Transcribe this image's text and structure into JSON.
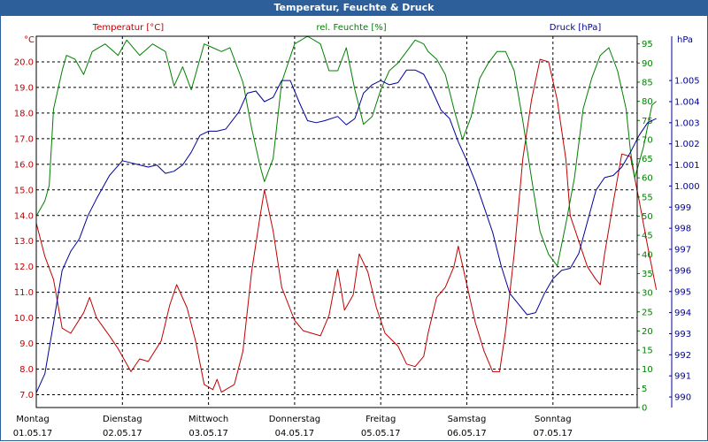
{
  "window": {
    "title": "Temperatur, Feuchte & Druck"
  },
  "chart_data": {
    "type": "line",
    "title": "Temperatur, Feuchte & Druck",
    "grid": true,
    "x_range_days": [
      0,
      7
    ],
    "x_ticks": [
      {
        "day": "Montag",
        "date": "01.05.17"
      },
      {
        "day": "Dienstag",
        "date": "02.05.17"
      },
      {
        "day": "Mittwoch",
        "date": "03.05.17"
      },
      {
        "day": "Donnerstag",
        "date": "04.05.17"
      },
      {
        "day": "Freitag",
        "date": "05.05.17"
      },
      {
        "day": "Samstag",
        "date": "06.05.17"
      },
      {
        "day": "Sonntag",
        "date": "07.05.17"
      }
    ],
    "axes": {
      "temperature": {
        "label": "Temperatur [°C]",
        "unit": "°C",
        "color": "#c00000",
        "range": [
          6.5,
          21.0
        ],
        "ticks": [
          "7.0",
          "8.0",
          "9.0",
          "10.0",
          "11.0",
          "12.0",
          "13.0",
          "14.0",
          "15.0",
          "16.0",
          "17.0",
          "18.0",
          "19.0",
          "20.0"
        ]
      },
      "humidity": {
        "label": "rel. Feuchte [%]",
        "unit": "%",
        "color": "#008000",
        "range": [
          0,
          97
        ],
        "ticks": [
          "0",
          "5",
          "10",
          "15",
          "20",
          "25",
          "30",
          "35",
          "40",
          "45",
          "50",
          "55",
          "60",
          "65",
          "70",
          "75",
          "80",
          "85",
          "90",
          "95"
        ]
      },
      "pressure": {
        "label": "Druck [hPa]",
        "unit": "hPa",
        "color": "#000099",
        "range": [
          989.5,
          1007.1
        ],
        "ticks": [
          "990",
          "991",
          "992",
          "993",
          "994",
          "995",
          "996",
          "997",
          "998",
          "999",
          "1.000",
          "1.001",
          "1.002",
          "1.003",
          "1.004",
          "1.005"
        ]
      }
    },
    "series": [
      {
        "name": "Temperatur [°C]",
        "axis": "temperature",
        "color": "#c00000",
        "points": [
          [
            0,
            13.7
          ],
          [
            0.1,
            12.4
          ],
          [
            0.2,
            11.5
          ],
          [
            0.3,
            9.6
          ],
          [
            0.4,
            9.4
          ],
          [
            0.55,
            10.2
          ],
          [
            0.62,
            10.8
          ],
          [
            0.7,
            10.0
          ],
          [
            0.85,
            9.3
          ],
          [
            0.95,
            8.8
          ],
          [
            1.1,
            7.9
          ],
          [
            1.2,
            8.4
          ],
          [
            1.3,
            8.3
          ],
          [
            1.45,
            9.1
          ],
          [
            1.55,
            10.5
          ],
          [
            1.63,
            11.3
          ],
          [
            1.75,
            10.4
          ],
          [
            1.85,
            9.1
          ],
          [
            1.95,
            7.4
          ],
          [
            2.05,
            7.2
          ],
          [
            2.1,
            7.6
          ],
          [
            2.15,
            7.1
          ],
          [
            2.3,
            7.4
          ],
          [
            2.4,
            8.7
          ],
          [
            2.5,
            11.8
          ],
          [
            2.6,
            14.0
          ],
          [
            2.65,
            15.0
          ],
          [
            2.75,
            13.4
          ],
          [
            2.85,
            11.2
          ],
          [
            3.0,
            9.9
          ],
          [
            3.1,
            9.5
          ],
          [
            3.2,
            9.4
          ],
          [
            3.3,
            9.3
          ],
          [
            3.4,
            10.1
          ],
          [
            3.5,
            11.9
          ],
          [
            3.58,
            10.3
          ],
          [
            3.68,
            10.9
          ],
          [
            3.75,
            12.5
          ],
          [
            3.85,
            11.8
          ],
          [
            3.95,
            10.4
          ],
          [
            4.05,
            9.4
          ],
          [
            4.2,
            8.9
          ],
          [
            4.3,
            8.2
          ],
          [
            4.4,
            8.1
          ],
          [
            4.5,
            8.5
          ],
          [
            4.55,
            9.4
          ],
          [
            4.65,
            10.8
          ],
          [
            4.75,
            11.2
          ],
          [
            4.85,
            12.0
          ],
          [
            4.9,
            12.8
          ],
          [
            5.0,
            11.3
          ],
          [
            5.1,
            9.8
          ],
          [
            5.2,
            8.7
          ],
          [
            5.3,
            7.9
          ],
          [
            5.38,
            7.9
          ],
          [
            5.45,
            9.5
          ],
          [
            5.55,
            12.5
          ],
          [
            5.65,
            16.2
          ],
          [
            5.75,
            18.5
          ],
          [
            5.85,
            20.1
          ],
          [
            5.95,
            20.0
          ],
          [
            6.05,
            18.5
          ],
          [
            6.15,
            16.2
          ],
          [
            6.2,
            14.0
          ],
          [
            6.3,
            13.0
          ],
          [
            6.4,
            12.0
          ],
          [
            6.5,
            11.5
          ],
          [
            6.55,
            11.3
          ],
          [
            6.6,
            12.5
          ],
          [
            6.7,
            14.5
          ],
          [
            6.8,
            16.4
          ],
          [
            6.9,
            16.3
          ],
          [
            7.0,
            14.6
          ],
          [
            7.1,
            12.8
          ],
          [
            7.2,
            11.1
          ]
        ]
      },
      {
        "name": "rel. Feuchte [%]",
        "axis": "humidity",
        "color": "#008000",
        "points": [
          [
            0,
            50
          ],
          [
            0.1,
            54
          ],
          [
            0.15,
            58
          ],
          [
            0.2,
            78
          ],
          [
            0.3,
            88
          ],
          [
            0.35,
            92
          ],
          [
            0.45,
            91
          ],
          [
            0.55,
            87
          ],
          [
            0.65,
            93
          ],
          [
            0.8,
            95
          ],
          [
            0.95,
            92
          ],
          [
            1.05,
            96
          ],
          [
            1.2,
            92
          ],
          [
            1.35,
            95
          ],
          [
            1.5,
            93
          ],
          [
            1.6,
            84
          ],
          [
            1.7,
            89
          ],
          [
            1.8,
            83
          ],
          [
            1.95,
            95
          ],
          [
            2.05,
            94
          ],
          [
            2.15,
            93
          ],
          [
            2.25,
            94
          ],
          [
            2.4,
            85
          ],
          [
            2.5,
            73
          ],
          [
            2.6,
            63
          ],
          [
            2.65,
            59
          ],
          [
            2.75,
            65
          ],
          [
            2.85,
            85
          ],
          [
            3.0,
            95
          ],
          [
            3.15,
            97
          ],
          [
            3.3,
            95
          ],
          [
            3.4,
            88
          ],
          [
            3.5,
            88
          ],
          [
            3.6,
            94
          ],
          [
            3.7,
            83
          ],
          [
            3.8,
            74
          ],
          [
            3.9,
            76
          ],
          [
            4.0,
            83
          ],
          [
            4.1,
            88
          ],
          [
            4.2,
            90
          ],
          [
            4.3,
            93
          ],
          [
            4.4,
            96
          ],
          [
            4.5,
            95
          ],
          [
            4.55,
            93
          ],
          [
            4.65,
            91
          ],
          [
            4.75,
            87
          ],
          [
            4.85,
            78
          ],
          [
            4.95,
            70
          ],
          [
            5.05,
            76
          ],
          [
            5.15,
            86
          ],
          [
            5.25,
            90
          ],
          [
            5.35,
            93
          ],
          [
            5.45,
            93
          ],
          [
            5.55,
            88
          ],
          [
            5.65,
            75
          ],
          [
            5.75,
            60
          ],
          [
            5.85,
            46
          ],
          [
            5.95,
            40
          ],
          [
            6.05,
            37
          ],
          [
            6.15,
            48
          ],
          [
            6.25,
            60
          ],
          [
            6.35,
            78
          ],
          [
            6.45,
            86
          ],
          [
            6.55,
            92
          ],
          [
            6.65,
            94
          ],
          [
            6.75,
            88
          ],
          [
            6.85,
            78
          ],
          [
            6.9,
            67
          ],
          [
            6.95,
            60
          ],
          [
            7.05,
            68
          ],
          [
            7.15,
            79
          ],
          [
            7.2,
            80
          ]
        ]
      },
      {
        "name": "Druck [hPa]",
        "axis": "pressure",
        "color": "#000099",
        "points": [
          [
            0,
            990.2
          ],
          [
            0.1,
            991.1
          ],
          [
            0.2,
            993.5
          ],
          [
            0.3,
            996.0
          ],
          [
            0.4,
            996.9
          ],
          [
            0.5,
            997.5
          ],
          [
            0.6,
            998.6
          ],
          [
            0.7,
            999.4
          ],
          [
            0.85,
            1000.5
          ],
          [
            1.0,
            1001.2
          ],
          [
            1.1,
            1001.1
          ],
          [
            1.2,
            1001.0
          ],
          [
            1.3,
            1000.9
          ],
          [
            1.4,
            1001.0
          ],
          [
            1.5,
            1000.6
          ],
          [
            1.6,
            1000.7
          ],
          [
            1.7,
            1001.0
          ],
          [
            1.8,
            1001.6
          ],
          [
            1.9,
            1002.4
          ],
          [
            2.0,
            1002.6
          ],
          [
            2.1,
            1002.6
          ],
          [
            2.2,
            1002.7
          ],
          [
            2.35,
            1003.5
          ],
          [
            2.45,
            1004.4
          ],
          [
            2.55,
            1004.5
          ],
          [
            2.65,
            1004.0
          ],
          [
            2.75,
            1004.2
          ],
          [
            2.85,
            1005.0
          ],
          [
            2.95,
            1005.0
          ],
          [
            3.05,
            1004.0
          ],
          [
            3.15,
            1003.1
          ],
          [
            3.25,
            1003.0
          ],
          [
            3.35,
            1003.1
          ],
          [
            3.5,
            1003.3
          ],
          [
            3.6,
            1002.9
          ],
          [
            3.7,
            1003.2
          ],
          [
            3.8,
            1004.4
          ],
          [
            3.9,
            1004.8
          ],
          [
            4.0,
            1005.0
          ],
          [
            4.1,
            1004.8
          ],
          [
            4.2,
            1004.9
          ],
          [
            4.3,
            1005.5
          ],
          [
            4.4,
            1005.5
          ],
          [
            4.5,
            1005.3
          ],
          [
            4.6,
            1004.5
          ],
          [
            4.7,
            1003.6
          ],
          [
            4.8,
            1003.2
          ],
          [
            4.9,
            1002.1
          ],
          [
            5.0,
            1001.2
          ],
          [
            5.1,
            1000.2
          ],
          [
            5.2,
            999.0
          ],
          [
            5.3,
            997.8
          ],
          [
            5.4,
            996.2
          ],
          [
            5.5,
            994.9
          ],
          [
            5.6,
            994.4
          ],
          [
            5.7,
            993.9
          ],
          [
            5.8,
            994.0
          ],
          [
            5.9,
            994.9
          ],
          [
            6.0,
            995.6
          ],
          [
            6.1,
            996.0
          ],
          [
            6.2,
            996.1
          ],
          [
            6.3,
            996.8
          ],
          [
            6.4,
            998.3
          ],
          [
            6.5,
            999.8
          ],
          [
            6.6,
            1000.4
          ],
          [
            6.7,
            1000.5
          ],
          [
            6.8,
            1000.9
          ],
          [
            6.9,
            1001.6
          ],
          [
            7.0,
            1002.4
          ],
          [
            7.1,
            1003.0
          ],
          [
            7.2,
            1003.2
          ]
        ]
      }
    ]
  }
}
